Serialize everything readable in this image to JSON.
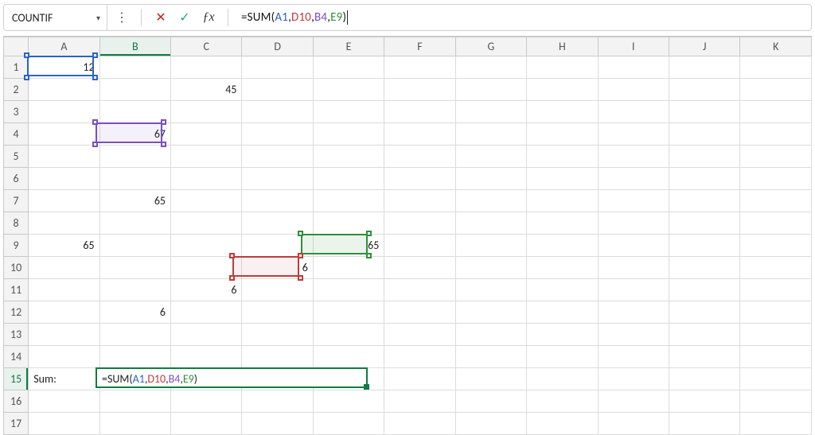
{
  "nameBox": {
    "value": "COUNTIF"
  },
  "formulaBar": {
    "prefix": "=SUM(",
    "arg1": "A1",
    "sep": ", ",
    "arg2": "D10",
    "arg3": "B4",
    "arg4": "E9",
    "suffix": ")"
  },
  "icons": {
    "dropdown": "▾",
    "dots": "⋮",
    "cancel": "✕",
    "enter": "✓",
    "fx": "ƒx"
  },
  "columns": [
    "A",
    "B",
    "C",
    "D",
    "E",
    "F",
    "G",
    "H",
    "I",
    "J",
    "K"
  ],
  "rows": [
    "1",
    "2",
    "3",
    "4",
    "5",
    "6",
    "7",
    "8",
    "9",
    "10",
    "11",
    "12",
    "13",
    "14",
    "15",
    "16",
    "17"
  ],
  "cells": {
    "A1": "12",
    "C2": "45",
    "B4": "67",
    "B7": "65",
    "A9": "65",
    "E9": "65",
    "D10": "6",
    "C11": "6",
    "B12": "6",
    "A15": "Sum:",
    "B15": "=SUM(A1, D10, B4, E9)"
  },
  "activeCell": "B15",
  "colors": {
    "argA1": "#2a63c8",
    "argD10": "#c23a3a",
    "argB4": "#7a4fbf",
    "argE9": "#2e8f3a",
    "editBorder": "#107c41"
  },
  "highlights": [
    {
      "ref": "A1",
      "color": "blue"
    },
    {
      "ref": "B4",
      "color": "purple"
    },
    {
      "ref": "E9",
      "color": "green"
    },
    {
      "ref": "D10",
      "color": "red"
    }
  ]
}
